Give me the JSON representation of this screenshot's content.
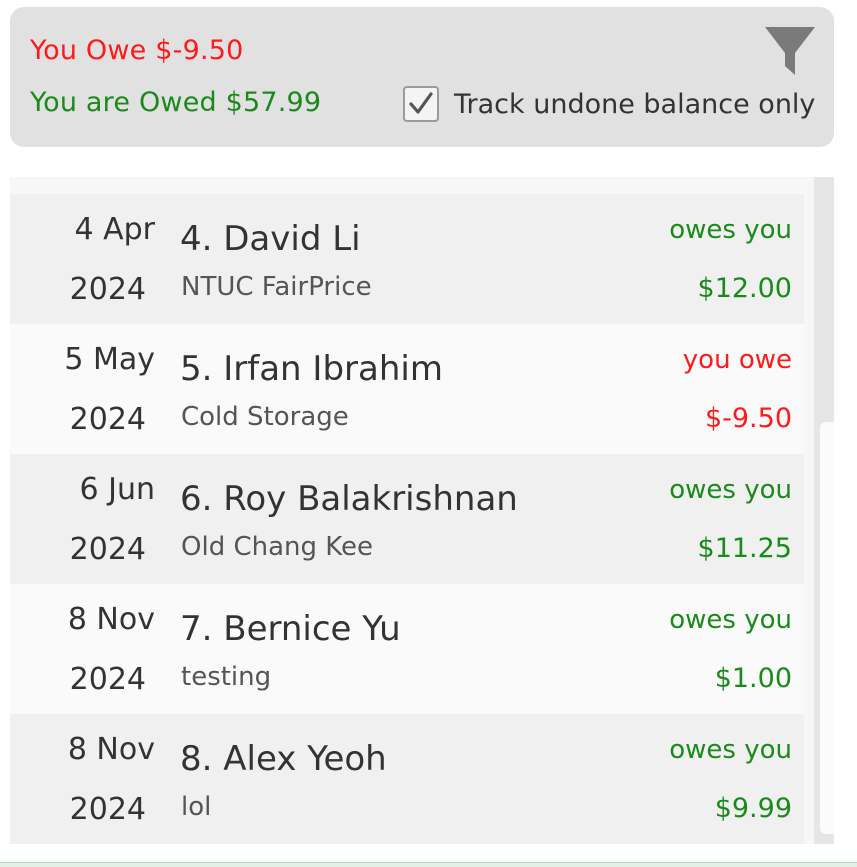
{
  "summary": {
    "you_owe": "You Owe $-9.50",
    "you_are_owed": "You are Owed $57.99",
    "track_undone_label": "Track undone balance only",
    "track_undone_checked": true
  },
  "icons": {
    "filter": "filter-funnel-icon",
    "checkmark": "checkmark-icon"
  },
  "colors": {
    "owe": "#ff1a1a",
    "owed": "#1a8a1a",
    "panel": "#e1e1e1"
  },
  "transactions": [
    {
      "day": "4 Apr",
      "year": "2024",
      "name": "4. David Li",
      "merchant": "NTUC FairPrice",
      "status": "owes you",
      "amount": "$12.00",
      "direction": "owed"
    },
    {
      "day": "5 May",
      "year": "2024",
      "name": "5. Irfan Ibrahim",
      "merchant": "Cold Storage",
      "status": "you owe",
      "amount": "$-9.50",
      "direction": "owe"
    },
    {
      "day": "6 Jun",
      "year": "2024",
      "name": "6. Roy Balakrishnan",
      "merchant": "Old Chang Kee",
      "status": "owes you",
      "amount": "$11.25",
      "direction": "owed"
    },
    {
      "day": "8 Nov",
      "year": "2024",
      "name": "7. Bernice Yu",
      "merchant": "testing",
      "status": "owes you",
      "amount": "$1.00",
      "direction": "owed"
    },
    {
      "day": "8 Nov",
      "year": "2024",
      "name": "8. Alex Yeoh",
      "merchant": "lol",
      "status": "owes you",
      "amount": "$9.99",
      "direction": "owed"
    }
  ]
}
